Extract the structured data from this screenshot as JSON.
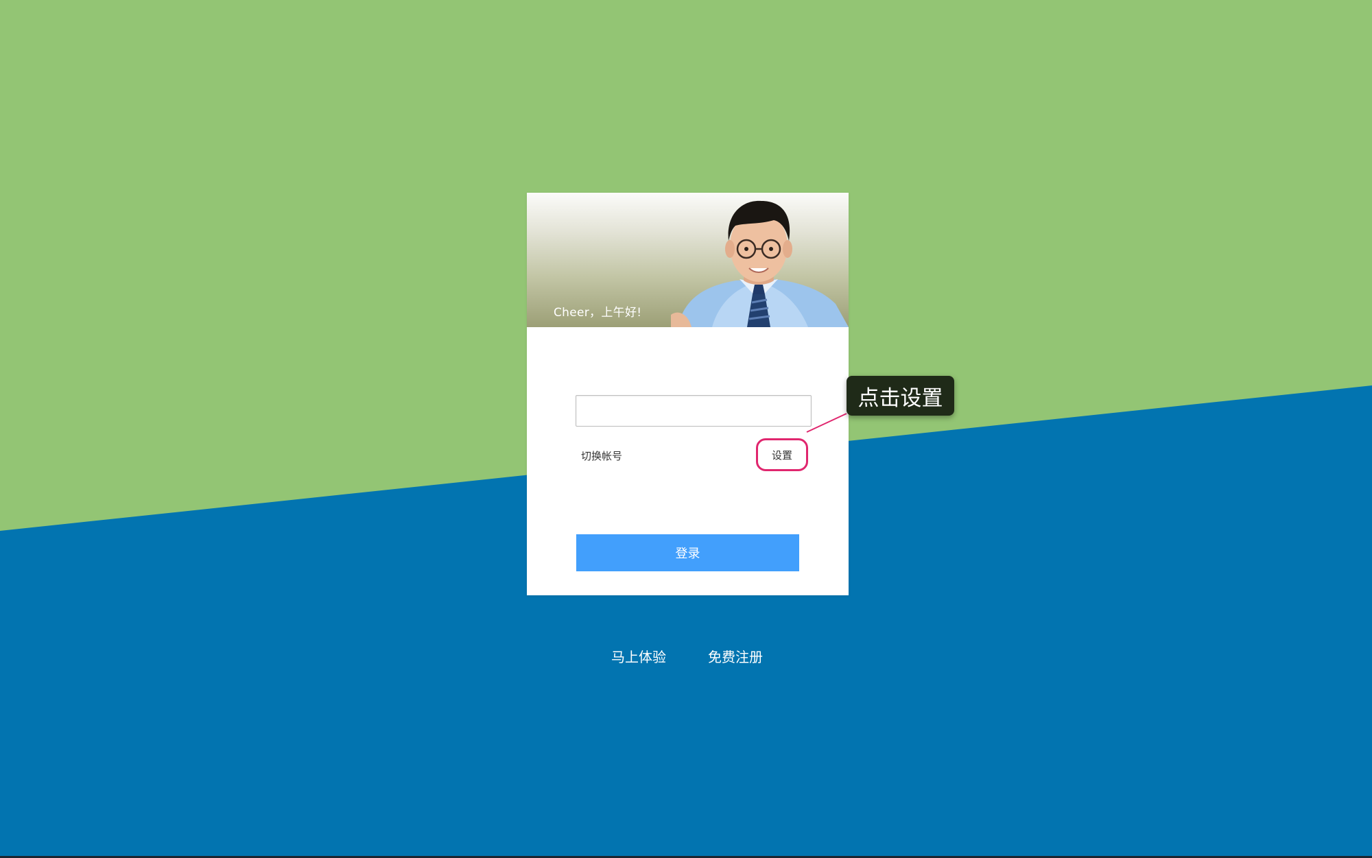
{
  "colors": {
    "background_green": "#93c574",
    "background_blue": "#0274b0",
    "login_button": "#429ffc",
    "highlight_ring": "#e0266e",
    "tooltip_bg": "#1f2a18"
  },
  "banner": {
    "greeting": "Cheer，上午好!",
    "image": "portrait-photo"
  },
  "login": {
    "account_value": "",
    "switch_account_label": "切换帐号",
    "settings_label": "设置",
    "login_button_label": "登录"
  },
  "annotation": {
    "text": "点击设置"
  },
  "footer": {
    "try_now": "马上体验",
    "free_register": "免费注册"
  }
}
